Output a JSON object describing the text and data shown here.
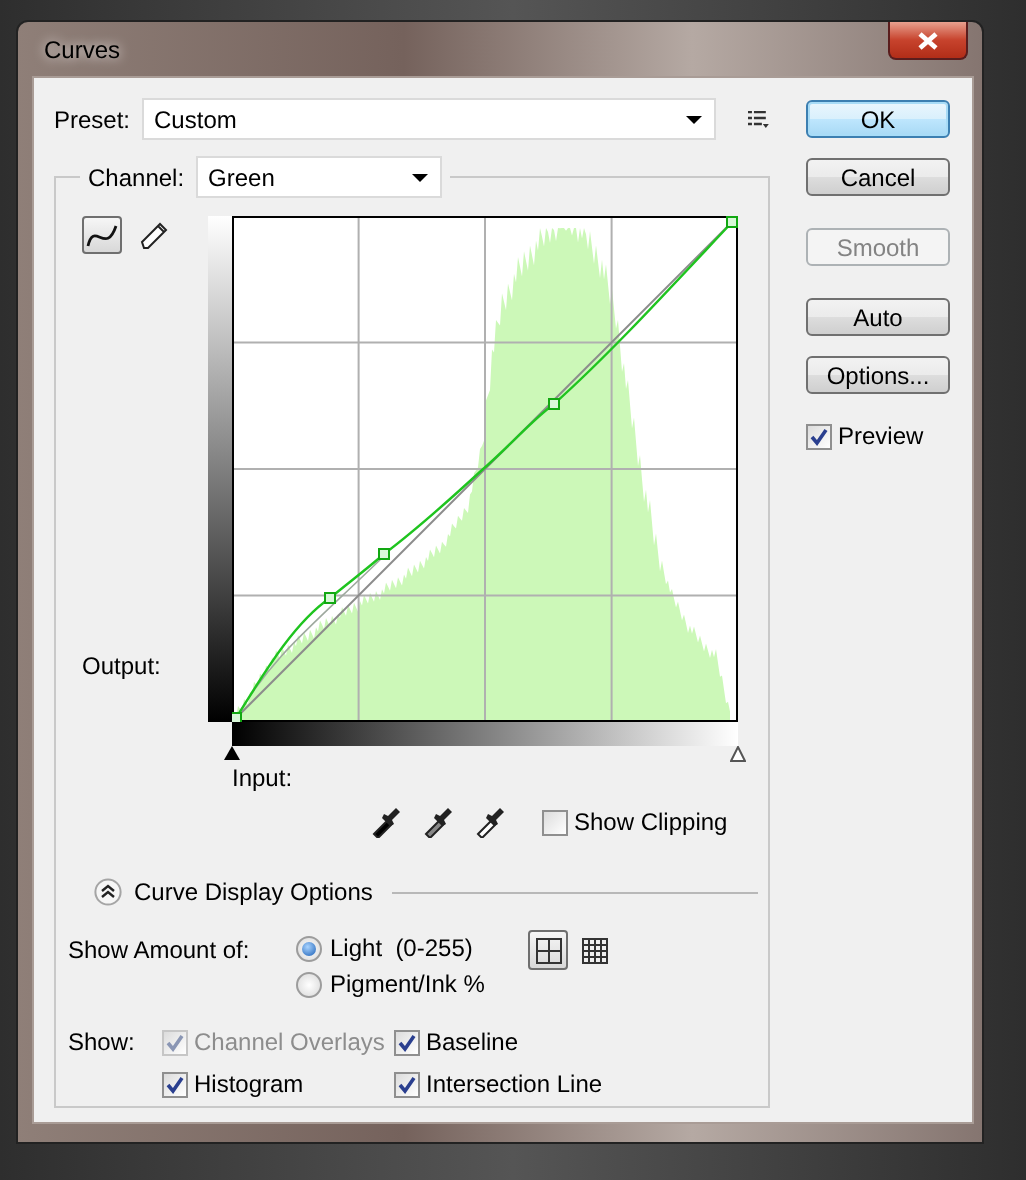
{
  "window": {
    "title": "Curves"
  },
  "preset": {
    "label": "Preset:",
    "value": "Custom"
  },
  "buttons": [
    {
      "label": "OK",
      "default": true,
      "disabled": false
    },
    {
      "label": "Cancel",
      "default": false,
      "disabled": false
    },
    {
      "label": "Smooth",
      "default": false,
      "disabled": true
    },
    {
      "label": "Auto",
      "default": false,
      "disabled": false
    },
    {
      "label": "Options...",
      "default": false,
      "disabled": false
    }
  ],
  "preview": {
    "label": "Preview",
    "checked": true
  },
  "channel": {
    "label": "Channel:",
    "value": "Green"
  },
  "tools": [
    {
      "kind": "curve",
      "selected": true
    },
    {
      "kind": "pencil",
      "selected": false
    }
  ],
  "graph": {
    "output_label": "Output:",
    "input_label": "Input:"
  },
  "input_sliders": [
    {
      "level": 0
    },
    {
      "level": 1
    }
  ],
  "show_clipping": {
    "label": "Show Clipping",
    "checked": false
  },
  "display_options": {
    "title": "Curve Display Options",
    "expanded": true
  },
  "show_amount": {
    "label": "Show Amount of:",
    "options": [
      {
        "label": "Light  (0-255)",
        "selected": true
      },
      {
        "label": "Pigment/Ink %",
        "selected": false
      }
    ]
  },
  "grid_size": [
    {
      "kind": "coarse",
      "selected": true
    },
    {
      "kind": "fine",
      "selected": false
    }
  ],
  "show": {
    "label": "Show:",
    "options": [
      {
        "label": "Channel Overlays",
        "checked": true,
        "disabled": true
      },
      {
        "label": "Baseline",
        "checked": true,
        "disabled": false
      },
      {
        "label": "Histogram",
        "checked": true,
        "disabled": false
      },
      {
        "label": "Intersection Line",
        "checked": true,
        "disabled": false
      }
    ]
  }
}
